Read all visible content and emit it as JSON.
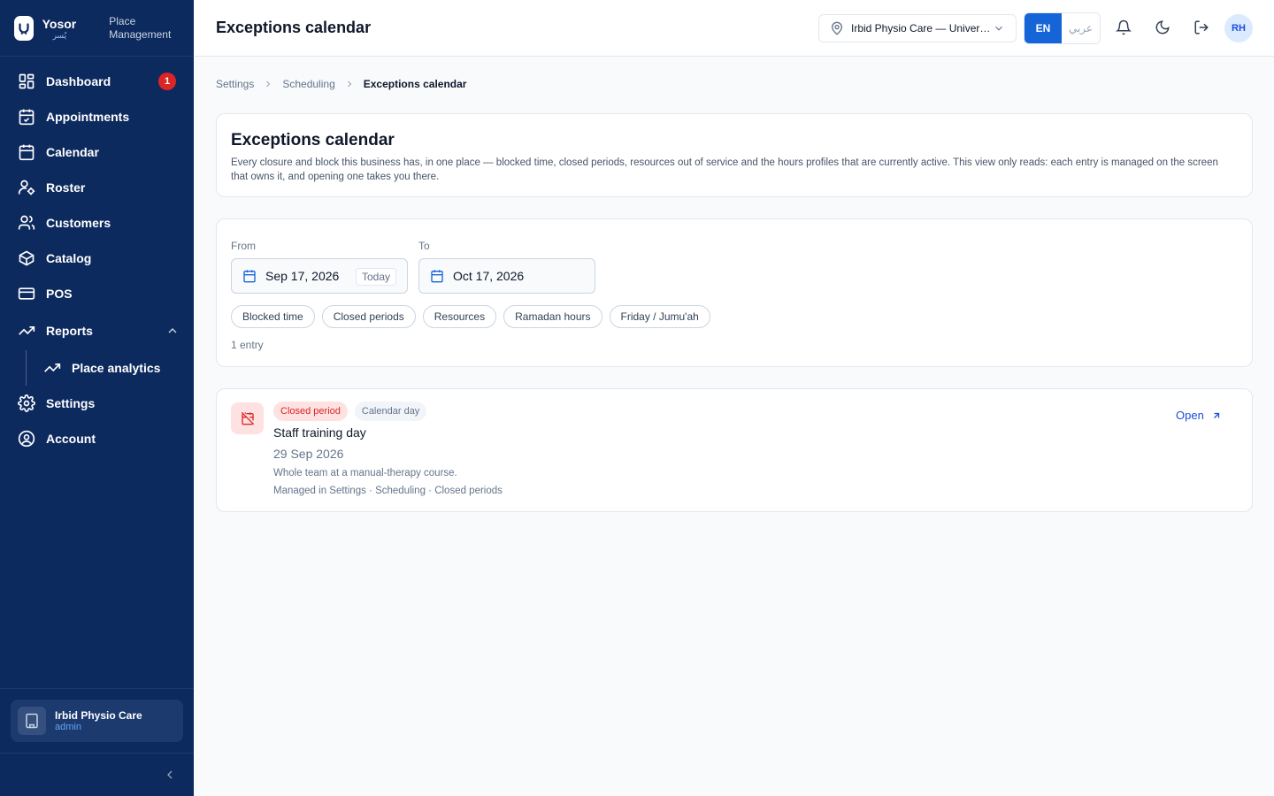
{
  "brand": {
    "name": "Yosor",
    "name_ar": "يُسر",
    "product": "Place Management"
  },
  "sidebar": {
    "items": [
      {
        "label": "Dashboard",
        "icon": "dashboard-icon",
        "badge": "1"
      },
      {
        "label": "Appointments",
        "icon": "calendar-check-icon"
      },
      {
        "label": "Calendar",
        "icon": "calendar-icon"
      },
      {
        "label": "Roster",
        "icon": "user-cog-icon"
      },
      {
        "label": "Customers",
        "icon": "users-icon"
      },
      {
        "label": "Catalog",
        "icon": "package-icon"
      },
      {
        "label": "POS",
        "icon": "credit-card-icon"
      },
      {
        "label": "Reports",
        "icon": "trending-up-icon",
        "expanded": true
      },
      {
        "label": "Place analytics",
        "icon": "trending-up-icon",
        "sub": true
      },
      {
        "label": "Settings",
        "icon": "gear-icon"
      },
      {
        "label": "Account",
        "icon": "user-circle-icon"
      }
    ],
    "account": {
      "name": "Irbid Physio Care",
      "role": "admin"
    }
  },
  "header": {
    "title": "Exceptions calendar",
    "place": "Irbid Physio Care — University Street",
    "lang_en": "EN",
    "lang_ar": "عربي",
    "avatar": "RH"
  },
  "breadcrumb": [
    "Settings",
    "Scheduling",
    "Exceptions calendar"
  ],
  "intro": {
    "title": "Exceptions calendar",
    "description": "Every closure and block this business has, in one place — blocked time, closed periods, resources out of service and the hours profiles that are currently active. This view only reads: each entry is managed on the screen that owns it, and opening one takes you there."
  },
  "filters": {
    "from_label": "From",
    "from_value": "Sep 17, 2026",
    "today_label": "Today",
    "to_label": "To",
    "to_value": "Oct 17, 2026",
    "chips": [
      "Blocked time",
      "Closed periods",
      "Resources",
      "Ramadan hours",
      "Friday / Jumu'ah"
    ],
    "count": "1 entry"
  },
  "entries": [
    {
      "tag_type": "Closed period",
      "tag_kind": "Calendar day",
      "title": "Staff training day",
      "date": "29 Sep 2026",
      "description": "Whole team at a manual-therapy course.",
      "managed": "Managed in Settings · Scheduling · Closed periods",
      "open_label": "Open"
    }
  ],
  "colors": {
    "sidebar": "#0d2a5e",
    "accent": "#1565d8",
    "danger": "#dc2626"
  }
}
